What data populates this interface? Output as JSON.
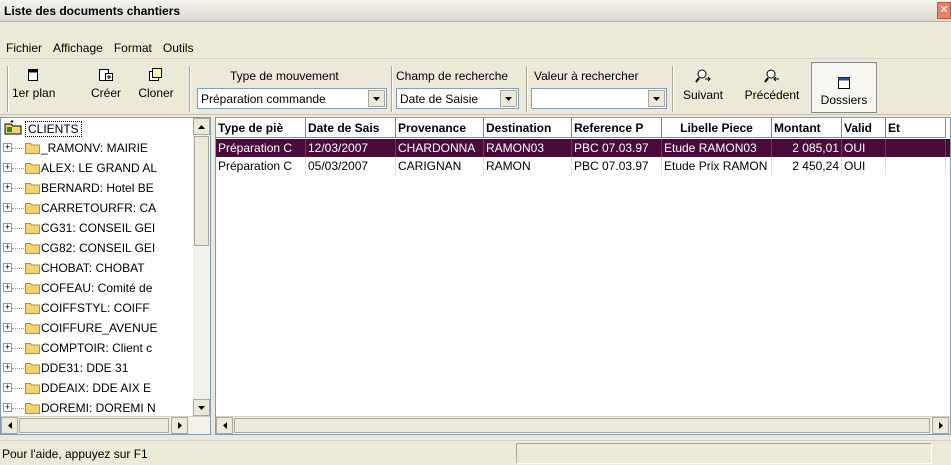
{
  "window": {
    "title": "Liste des documents chantiers",
    "close_glyph": "✕"
  },
  "menu": [
    "Fichier",
    "Affichage",
    "Format",
    "Outils"
  ],
  "toolbar": {
    "foreground_label": "1er plan",
    "create_label": "Créer",
    "clone_label": "Cloner",
    "movement_type_label": "Type de mouvement",
    "movement_type_value": "Préparation commande",
    "search_field_label": "Champ de recherche",
    "search_field_value": "Date de Saisie",
    "search_value_label": "Valeur à rechercher",
    "search_value_value": "",
    "next_label": "Suivant",
    "previous_label": "Précédent",
    "folders_label": "Dossiers"
  },
  "tree": {
    "root": "CLIENTS",
    "items": [
      "_RAMONV: MAIRIE",
      "ALEX: LE GRAND AL",
      "BERNARD: Hotel BE",
      "CARRETOURFR: CA",
      "CG31: CONSEIL GEI",
      "CG82: CONSEIL GEI",
      "CHOBAT: CHOBAT",
      "COFEAU: Comité de",
      "COIFFSTYL: COIFF",
      "COIFFURE_AVENUE",
      "COMPTOIR: Client c",
      "DDE31: DDE 31",
      "DDEAIX: DDE AIX E",
      "DOREMI: DOREMI N"
    ]
  },
  "grid": {
    "columns": [
      "Type de piè",
      "Date de Sais",
      "Provenance",
      "Destination",
      "Reference P",
      "Libelle Piece",
      "Montant",
      "Valid",
      "Et"
    ],
    "rows": [
      [
        "Préparation C",
        "12/03/2007",
        "CHARDONNA",
        "RAMON03",
        "PBC 07.03.97",
        "Etude RAMON03",
        "2 085,01",
        "OUI",
        ""
      ],
      [
        "Préparation C",
        "05/03/2007",
        "CARIGNAN",
        "RAMON",
        "PBC 07.03.97",
        "Etude Prix RAMON",
        "2 450,24",
        "OUI",
        ""
      ]
    ],
    "selected_row": 0
  },
  "statusbar": {
    "text": "Pour l'aide, appuyez sur F1"
  },
  "colors": {
    "selection": "#4b0a3c",
    "folder": "#f3d36b",
    "background": "#ece9d8"
  },
  "icons": [
    "foreground-icon",
    "create-icon",
    "clone-icon",
    "next-search-icon",
    "previous-search-icon",
    "folders-icon",
    "clients-root-icon",
    "folder-icon"
  ]
}
